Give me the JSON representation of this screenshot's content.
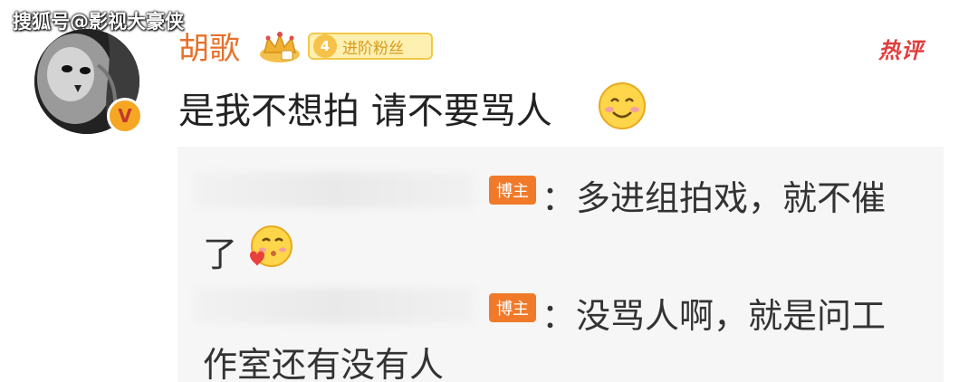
{
  "watermark": "搜狐号@影视大豪侠",
  "comment": {
    "username": "胡歌",
    "fan_badge_level": "4",
    "fan_badge_text": "进阶粉丝",
    "hot_label": "热评",
    "verify_mark": "V",
    "text": "是我不想拍 请不要骂人",
    "emoji": "smile-emoji"
  },
  "replies": [
    {
      "tag": "博主",
      "line1": "：多进组拍戏，就不催",
      "line2": "了",
      "emoji": "kiss-emoji"
    },
    {
      "tag": "博主",
      "line1": "：没骂人啊，就是问工",
      "line2": "作室还有没有人"
    }
  ]
}
